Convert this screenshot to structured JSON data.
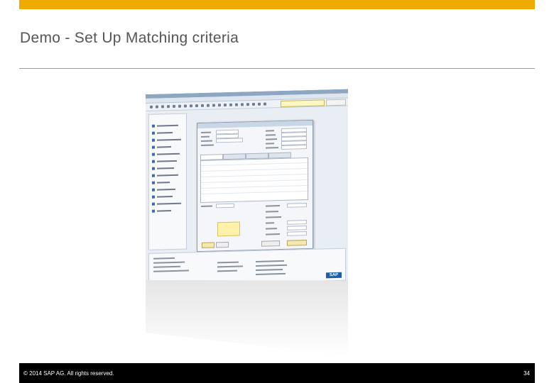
{
  "slide": {
    "title": "Demo - Set Up Matching criteria",
    "footer_copyright": "© 2014 SAP AG. All rights reserved.",
    "page_number": "34"
  },
  "screenshot": {
    "logo_text": "SAP"
  },
  "colors": {
    "accent_bar": "#f0ab00",
    "footer_bg": "#000000",
    "title_text": "#555555"
  }
}
